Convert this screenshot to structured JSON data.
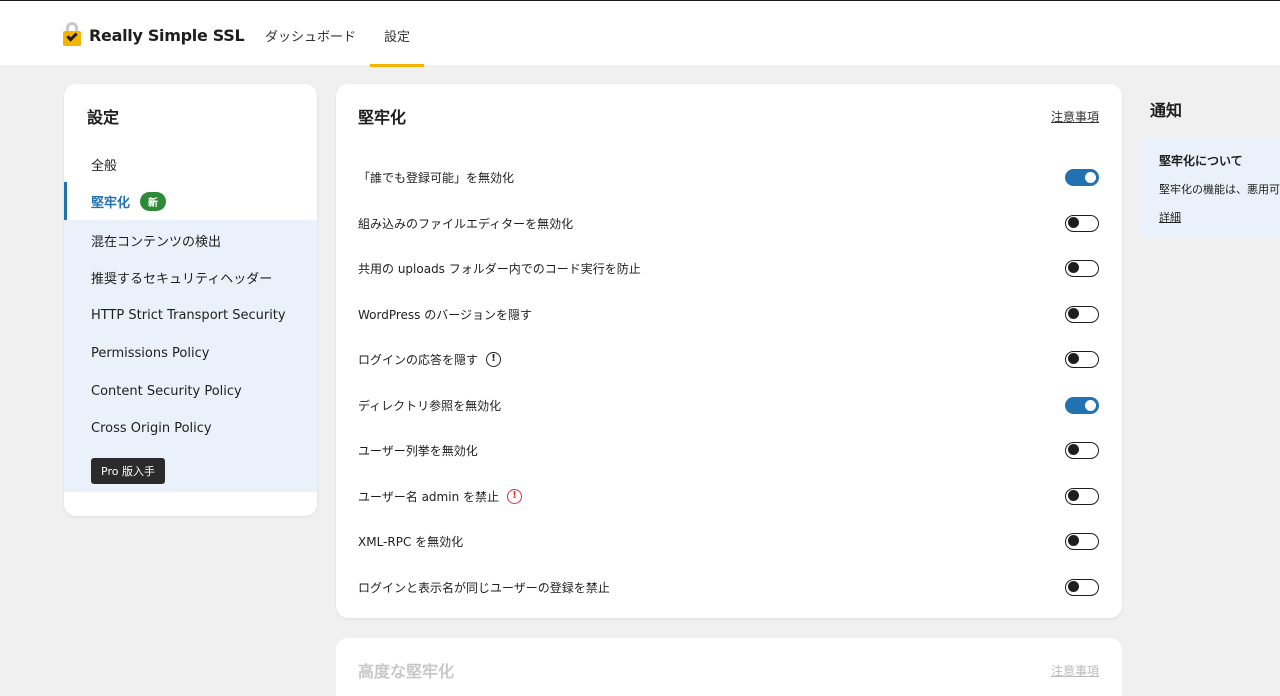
{
  "header": {
    "brand": "Really Simple SSL",
    "nav": [
      "ダッシュボード",
      "設定"
    ],
    "active_nav": "設定"
  },
  "sidebar": {
    "title": "設定",
    "items": [
      {
        "label": "全般"
      },
      {
        "label": "堅牢化",
        "badge": "新",
        "active": true
      },
      {
        "label": "混在コンテンツの検出"
      },
      {
        "label": "推奨するセキュリティヘッダー"
      },
      {
        "label": "HTTP Strict Transport Security"
      },
      {
        "label": "Permissions Policy"
      },
      {
        "label": "Content Security Policy"
      },
      {
        "label": "Cross Origin Policy"
      }
    ],
    "pro_button": "Pro 版入手"
  },
  "hardening": {
    "title": "堅牢化",
    "link": "注意事項",
    "rows": [
      {
        "label": "「誰でも登録可能」を無効化",
        "on": true
      },
      {
        "label": "組み込みのファイルエディターを無効化",
        "on": false
      },
      {
        "label": "共用の uploads フォルダー内でのコード実行を防止",
        "on": false
      },
      {
        "label": "WordPress のバージョンを隠す",
        "on": false
      },
      {
        "label": "ログインの応答を隠す",
        "on": false,
        "icon": "info-icon"
      },
      {
        "label": "ディレクトリ参照を無効化",
        "on": true
      },
      {
        "label": "ユーザー列挙を無効化",
        "on": false
      },
      {
        "label": "ユーザー名 admin を禁止",
        "on": false,
        "icon": "warning-icon"
      },
      {
        "label": "XML-RPC を無効化",
        "on": false
      },
      {
        "label": "ログインと表示名が同じユーザーの登録を禁止",
        "on": false
      }
    ]
  },
  "advanced": {
    "title": "高度な堅牢化",
    "link": "注意事項"
  },
  "notices": {
    "title": "通知",
    "card_title": "堅牢化について",
    "card_body": "堅牢化の機能は、悪用可",
    "card_link": "詳細"
  },
  "colors": {
    "accent": "#2271b1",
    "brand": "#f4b400",
    "badge": "#2e8a37",
    "warning": "#d63638"
  }
}
